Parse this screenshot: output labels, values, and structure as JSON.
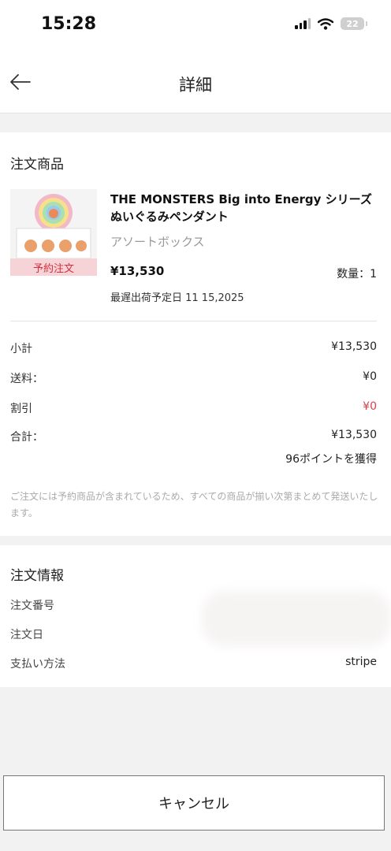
{
  "status_bar": {
    "time": "15:28",
    "battery": "22"
  },
  "nav": {
    "title": "詳細"
  },
  "products_section": {
    "title": "注文商品",
    "item": {
      "name": "THE MONSTERS Big into Energy シリーズ ぬいぐるみペンダント",
      "variant": "アソートボックス",
      "price": "¥13,530",
      "quantity": "数量：1",
      "ship_date": "最遅出荷予定日 11 15,2025",
      "badge": "予約注文"
    }
  },
  "summary": {
    "subtotal_label": "小計",
    "subtotal_value": "¥13,530",
    "shipping_label": "送料：",
    "shipping_value": "¥0",
    "discount_label": "割引",
    "discount_value": "¥0",
    "total_label": "合計：",
    "total_value": "¥13,530",
    "points": "96ポイントを獲得",
    "notice": "ご注文には予約商品が含まれているため、すべての商品が揃い次第まとめて発送いたします。"
  },
  "order_info": {
    "title": "注文情報",
    "order_number_label": "注文番号",
    "order_date_label": "注文日",
    "payment_label": "支払い方法",
    "payment_value": "stripe"
  },
  "footer": {
    "cancel_label": "キャンセル"
  },
  "colors": {
    "accent_red": "#d9404a",
    "badge_bg": "#f6d3d6",
    "page_bg": "#f2f2f2"
  }
}
